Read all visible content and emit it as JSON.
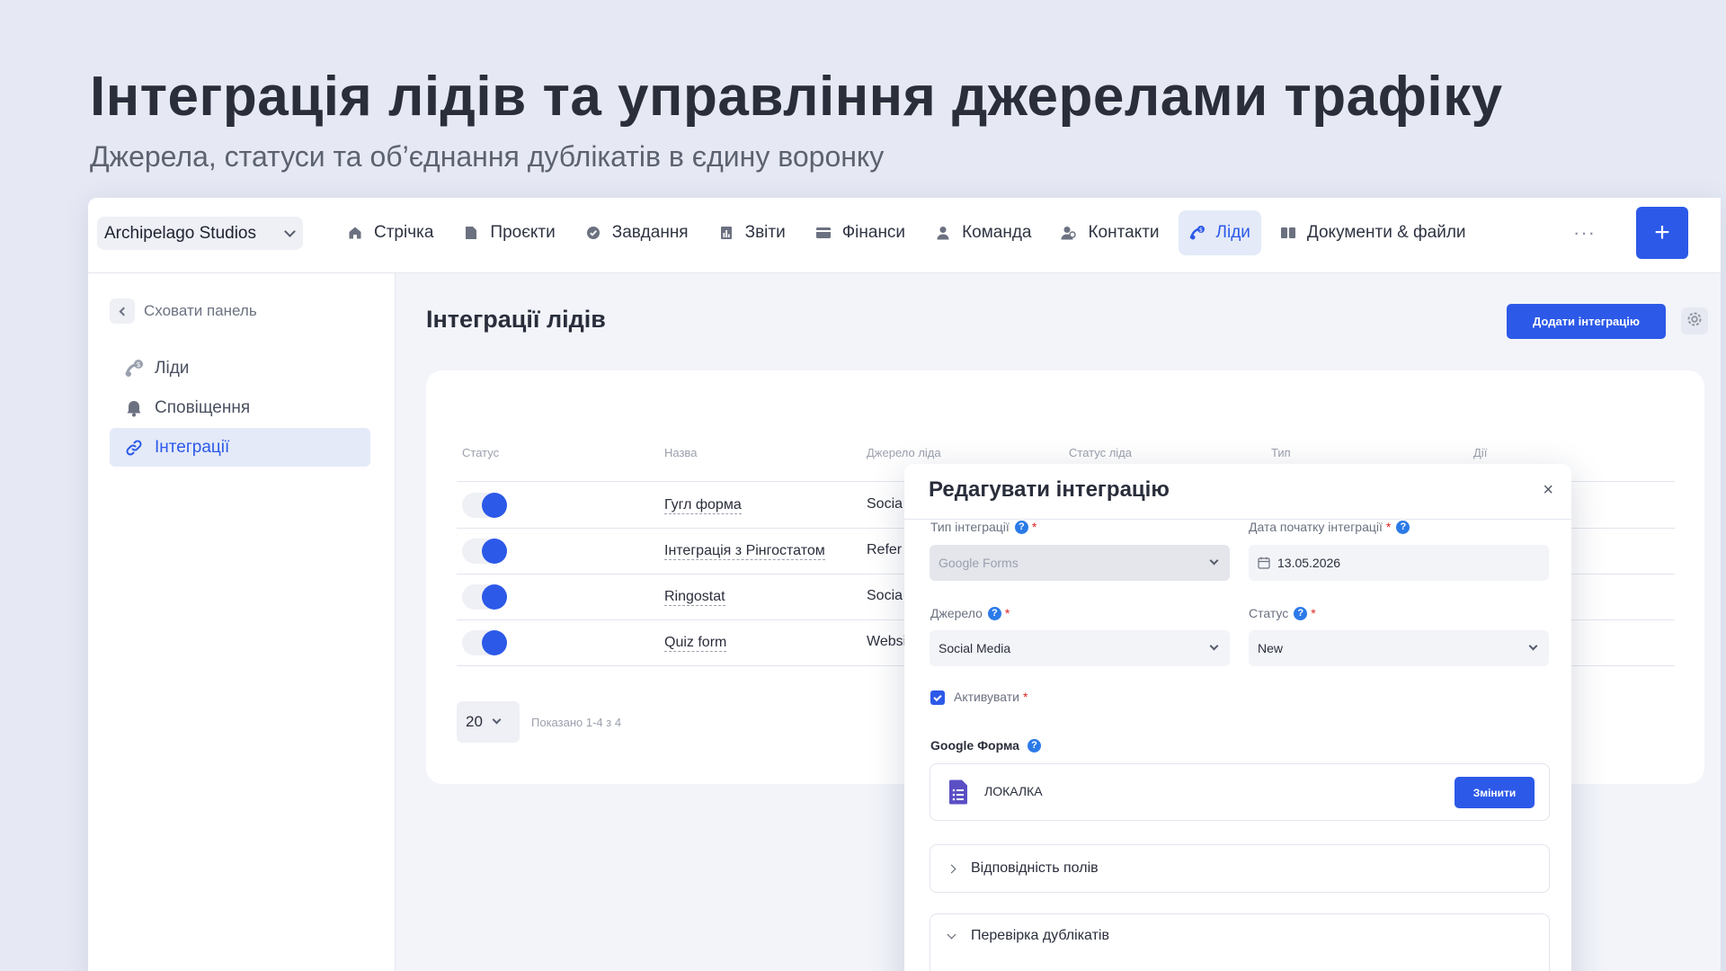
{
  "hero": {
    "title": "Інтеграція лідів та управління джерелами трафіку",
    "subtitle": "Джерела, статуси та об’єднання дублікатів в єдину воронку"
  },
  "topbar": {
    "workspace": "Archipelago Studios",
    "nav": [
      {
        "label": "Стрічка",
        "icon": "home-icon"
      },
      {
        "label": "Проєкти",
        "icon": "document-icon"
      },
      {
        "label": "Завдання",
        "icon": "check-circle-icon"
      },
      {
        "label": "Звіти",
        "icon": "report-icon"
      },
      {
        "label": "Фінанси",
        "icon": "wallet-icon"
      },
      {
        "label": "Команда",
        "icon": "person-icon"
      },
      {
        "label": "Контакти",
        "icon": "contacts-icon"
      },
      {
        "label": "Ліди",
        "icon": "leads-icon",
        "active": true
      },
      {
        "label": "Документи & файли",
        "icon": "book-icon"
      }
    ],
    "more": "···",
    "plus": "+"
  },
  "sidebar": {
    "hide": "Сховати панель",
    "items": [
      {
        "label": "Ліди",
        "icon": "leads-icon"
      },
      {
        "label": "Сповіщення",
        "icon": "bell-icon"
      },
      {
        "label": "Інтеграції",
        "icon": "link-icon",
        "active": true
      }
    ]
  },
  "main": {
    "title": "Інтеграції лідів",
    "add_button": "Додати інтеграцію",
    "columns": [
      "Статус",
      "Назва",
      "Джерело ліда",
      "Статус ліда",
      "Тип",
      "Дії"
    ],
    "rows": [
      {
        "name": "Гугл форма",
        "source": "Socia",
        "active": true
      },
      {
        "name": "Інтеграція з Рінгостатом",
        "source": "Refer",
        "active": true
      },
      {
        "name": "Ringostat",
        "source": "Socia",
        "active": true
      },
      {
        "name": "Quiz form",
        "source": "Websi",
        "active": true
      }
    ],
    "per_page": "20",
    "shown": "Показано 1-4 з 4"
  },
  "modal": {
    "title": "Редагувати інтеграцію",
    "close": "×",
    "type_label": "Тип інтеграції",
    "type_value": "Google Forms",
    "date_label": "Дата початку інтеграції",
    "date_value": "13.05.2026",
    "source_label": "Джерело",
    "source_value": "Social Media",
    "status_label": "Статус",
    "status_value": "New",
    "activate_label": "Активувати",
    "activate_checked": true,
    "gform_label": "Google Форма",
    "gform_name": "ЛОКАЛКА",
    "change_button": "Змінити",
    "fields_mapping": "Відповідність полів",
    "duplicate_check": "Перевірка дублікатів",
    "required_mark": "*",
    "help_mark": "?"
  },
  "colors": {
    "accent": "#2c59e8",
    "background": "#e6e9f4",
    "active_bg": "#e4eaf8",
    "required": "#e02424"
  }
}
